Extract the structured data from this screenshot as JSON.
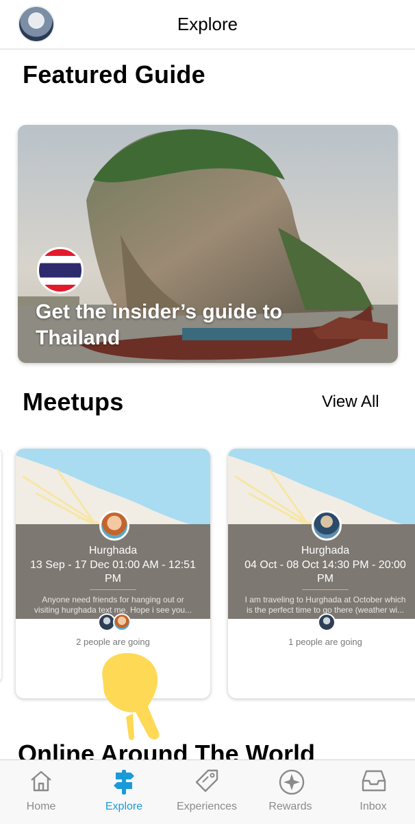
{
  "header": {
    "title": "Explore",
    "avatar_icon": "user-avatar"
  },
  "featured": {
    "heading": "Featured Guide",
    "title": "Get the insider’s guide to Thailand",
    "flag_icon": "thailand-flag-icon"
  },
  "meetups": {
    "heading": "Meetups",
    "view_all": "View All",
    "cards": [
      {
        "city": "Hurghada",
        "dates": "13 Sep - 17 Dec 01:00 AM - 12:51 PM",
        "description_line1": "Anyone need friends for hanging out or",
        "description_line2": "visiting hurghada text me. Hope i see you...",
        "going": "2 people are going"
      },
      {
        "city": "Hurghada",
        "dates": "04 Oct - 08 Oct 14:30 PM - 20:00 PM",
        "description_line1": "I am traveling to Hurghada at October which",
        "description_line2": "is the perfect time to go there (weather wi...",
        "going": "1 people are going"
      }
    ]
  },
  "online": {
    "heading": "Online Around The World"
  },
  "tabs": [
    {
      "label": "Home",
      "icon": "home-icon"
    },
    {
      "label": "Explore",
      "icon": "signpost-icon",
      "active": true
    },
    {
      "label": "Experiences",
      "icon": "tag-icon"
    },
    {
      "label": "Rewards",
      "icon": "rewards-star-icon"
    },
    {
      "label": "Inbox",
      "icon": "inbox-icon"
    }
  ],
  "colors": {
    "accent": "#1a9bd7",
    "map_water": "#a9dcf0",
    "band": "#76726c",
    "hand": "#fdd956"
  }
}
